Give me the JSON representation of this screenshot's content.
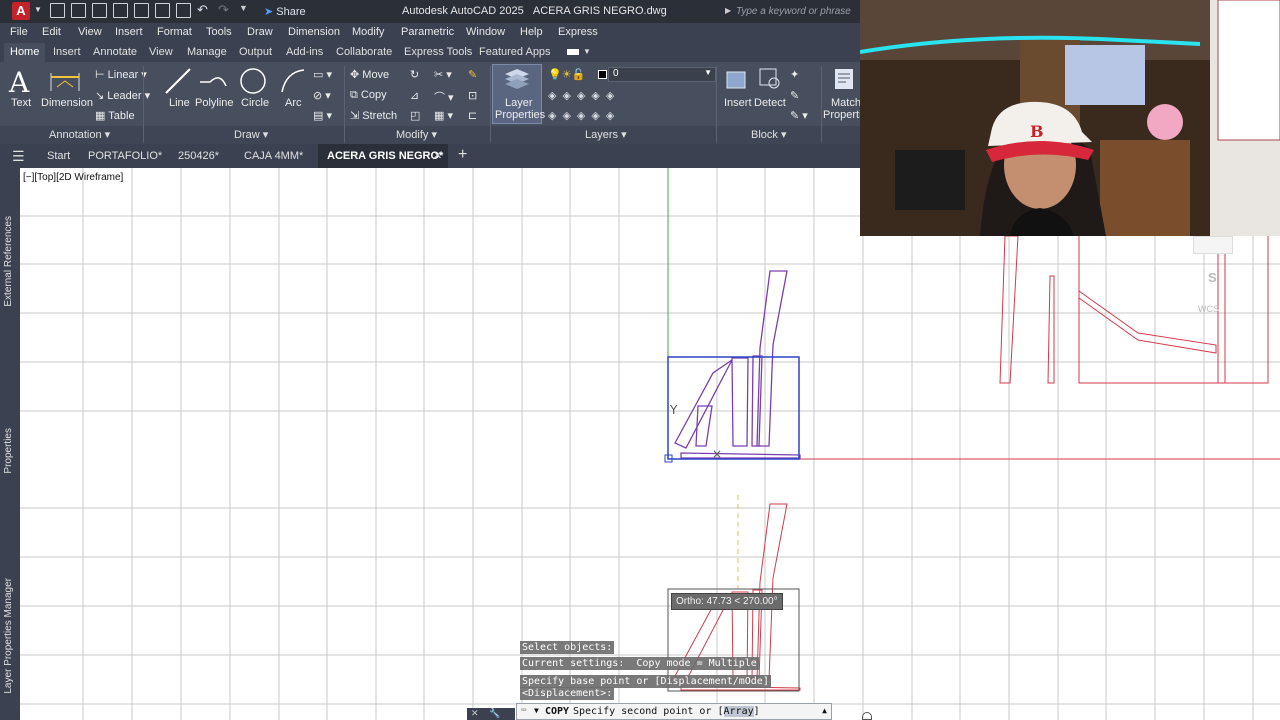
{
  "app": {
    "logo_letter": "A",
    "title": "Autodesk AutoCAD 2025",
    "document": "ACERA GRIS NEGRO.dwg",
    "share_label": "Share",
    "search_placeholder": "Type a keyword or phrase"
  },
  "menu": [
    "File",
    "Edit",
    "View",
    "Insert",
    "Format",
    "Tools",
    "Draw",
    "Dimension",
    "Modify",
    "Parametric",
    "Window",
    "Help",
    "Express"
  ],
  "ribbon_tabs": [
    "Home",
    "Insert",
    "Annotate",
    "View",
    "Manage",
    "Output",
    "Add-ins",
    "Collaborate",
    "Express Tools",
    "Featured Apps"
  ],
  "ribbon": {
    "annotation": {
      "text": "Text",
      "dimension": "Dimension",
      "linear": "Linear",
      "leader": "Leader",
      "table": "Table",
      "panel": "Annotation"
    },
    "draw": {
      "line": "Line",
      "polyline": "Polyline",
      "circle": "Circle",
      "arc": "Arc",
      "panel": "Draw"
    },
    "modify": {
      "move": "Move",
      "copy": "Copy",
      "stretch": "Stretch",
      "panel": "Modify"
    },
    "layers": {
      "properties": "Layer",
      "properties2": "Properties",
      "current_layer": "0",
      "panel": "Layers"
    },
    "block": {
      "insert": "Insert",
      "detect": "Detect",
      "panel": "Block"
    },
    "properties": {
      "match": "Match",
      "match2": "Properties"
    }
  },
  "file_tabs": [
    "Start",
    "PORTAFOLIO*",
    "250426*",
    "CAJA 4MM*",
    "ACERA GRIS NEGRO*"
  ],
  "palettes": [
    "External References",
    "Properties",
    "Layer Properties Manager"
  ],
  "viewport_label": "[−][Top][2D Wireframe]",
  "tooltip": "Ortho: 47.73 < 270.00°",
  "history": [
    "Select objects:",
    "Current settings:  Copy mode = Multiple",
    "Specify base point or [Displacement/mOde]",
    "<Displacement>:"
  ],
  "command": {
    "name": "COPY",
    "prompt": "Specify second point or [",
    "option": "Array",
    "close": "]"
  },
  "viewcube": {
    "letter": "S",
    "wcs": "WCS"
  },
  "colors": {
    "titlebar": "#2b2f38",
    "ribbon": "#474e5e",
    "selection": "#2d44c8",
    "object_purple": "#7b3fb0",
    "object_red": "#d43a4a"
  }
}
